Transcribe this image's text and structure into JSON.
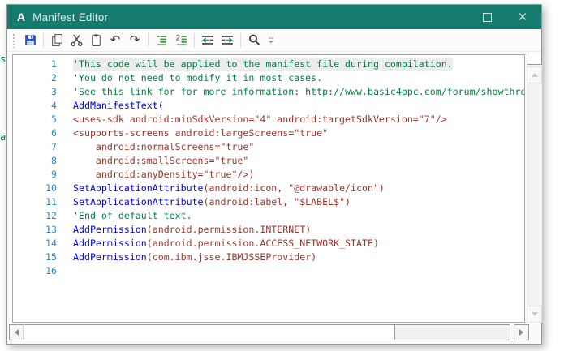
{
  "background": {
    "edge_text_top": "s",
    "edge_text_bottom": "at"
  },
  "window": {
    "logo": "A",
    "title": "Manifest Editor"
  },
  "toolbar": {
    "icons": [
      "save-icon",
      "copy-icon",
      "cut-icon",
      "paste-icon",
      "undo-icon",
      "redo-icon",
      "format-lines-icon",
      "format-selection-icon",
      "outdent-icon",
      "indent-icon",
      "search-icon",
      "toolbar-overflow-icon"
    ],
    "undo_glyph": "↶",
    "redo_glyph": "↷"
  },
  "colors": {
    "titlebar": "#177a6e",
    "comment": "#008040",
    "keyword": "#0000e0",
    "markup": "#9c352b",
    "line_number": "#2e86c4"
  },
  "editor": {
    "lines": [
      {
        "num": "1",
        "hl": true,
        "segs": [
          {
            "c": "comment",
            "t": "'This code will be applied to the manifest file during compilation."
          }
        ]
      },
      {
        "num": "2",
        "segs": [
          {
            "c": "comment",
            "t": "'You do not need to modify it in most cases."
          }
        ]
      },
      {
        "num": "3",
        "segs": [
          {
            "c": "comment",
            "t": "'See this link for for more information: http://www.basic4ppc.com/forum/showthre"
          }
        ]
      },
      {
        "num": "4",
        "segs": [
          {
            "c": "kw",
            "t": "AddManifestText("
          }
        ]
      },
      {
        "num": "5",
        "segs": [
          {
            "c": "str",
            "t": "<uses-sdk android:minSdkVersion=\"4\" android:targetSdkVersion=\"7\"/>"
          }
        ]
      },
      {
        "num": "6",
        "segs": [
          {
            "c": "str",
            "t": "<supports-screens android:largeScreens=\"true\""
          }
        ]
      },
      {
        "num": "7",
        "segs": [
          {
            "c": "str",
            "t": "    android:normalScreens=\"true\""
          }
        ]
      },
      {
        "num": "8",
        "segs": [
          {
            "c": "str",
            "t": "    android:smallScreens=\"true\""
          }
        ]
      },
      {
        "num": "9",
        "segs": [
          {
            "c": "str",
            "t": "    android:anyDensity=\"true\"/>)"
          }
        ]
      },
      {
        "num": "10",
        "segs": [
          {
            "c": "kw",
            "t": "SetApplicationAttribute"
          },
          {
            "c": "str",
            "t": "(android:icon, \"@drawable/icon\")"
          }
        ]
      },
      {
        "num": "11",
        "segs": [
          {
            "c": "kw",
            "t": "SetApplicationAttribute"
          },
          {
            "c": "str",
            "t": "(android:label, \"$LABEL$\")"
          }
        ]
      },
      {
        "num": "12",
        "segs": [
          {
            "c": "comment",
            "t": "'End of default text."
          }
        ]
      },
      {
        "num": "13",
        "segs": [
          {
            "c": "kw",
            "t": "AddPermission"
          },
          {
            "c": "str",
            "t": "(android.permission.INTERNET)"
          }
        ]
      },
      {
        "num": "14",
        "segs": [
          {
            "c": "kw",
            "t": "AddPermission"
          },
          {
            "c": "str",
            "t": "(android.permission.ACCESS_NETWORK_STATE)"
          }
        ]
      },
      {
        "num": "15",
        "segs": [
          {
            "c": "kw",
            "t": "AddPermission"
          },
          {
            "c": "str",
            "t": "(com.ibm.jsse.IBMJSSEProvider)"
          }
        ]
      },
      {
        "num": "16",
        "segs": []
      }
    ]
  }
}
